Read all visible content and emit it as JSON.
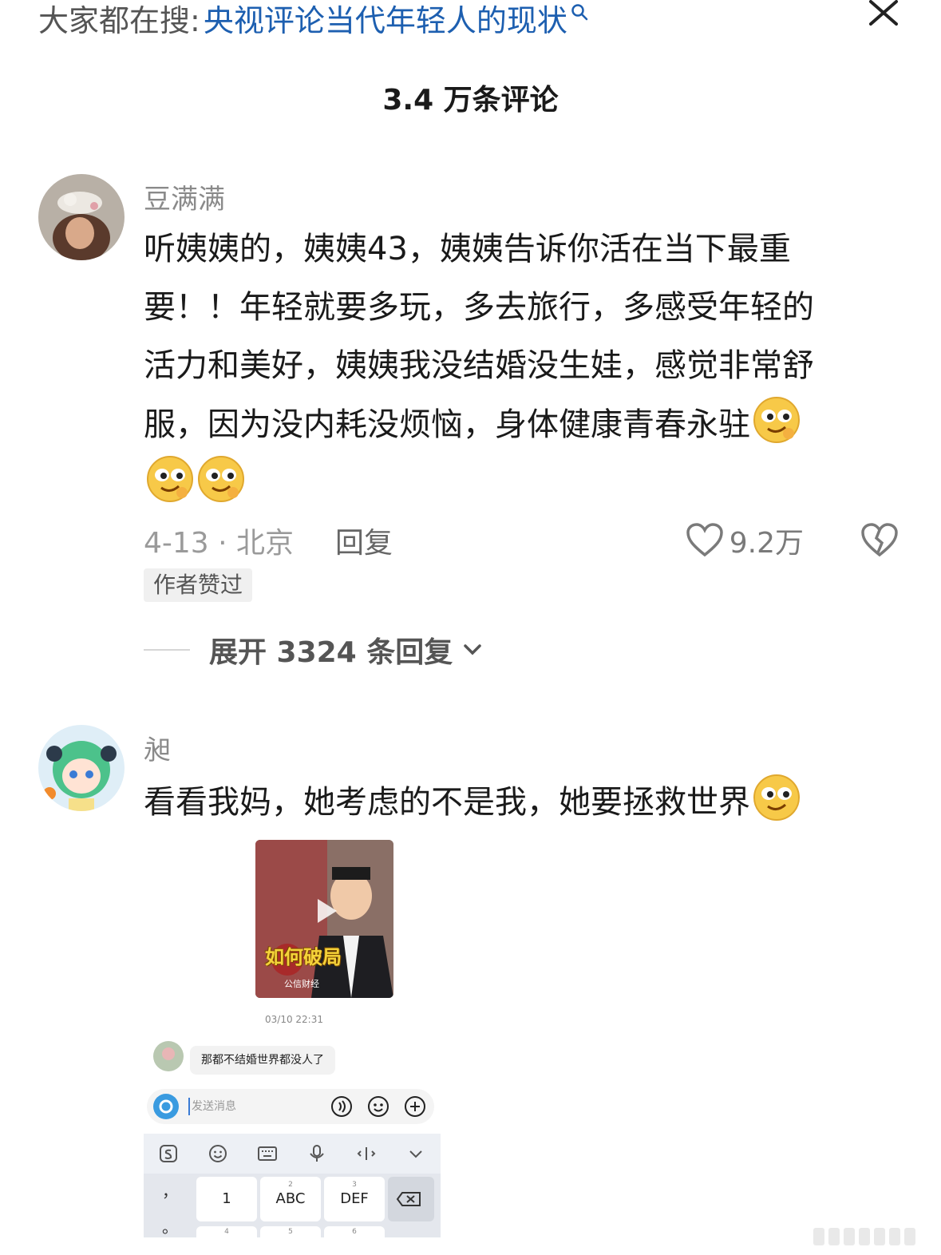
{
  "header": {
    "search_prefix": "大家都在搜:",
    "search_term": "央视评论当代年轻人的现状",
    "comment_count": "3.4 万条评论"
  },
  "comments": [
    {
      "username": "豆满满",
      "text_lines": [
        "听姨姨的，姨姨43，姨姨告诉你活在当下最重",
        "要！！年轻就要多玩，多去旅行，多感受年轻的",
        "活力和美好，姨姨我没结婚没生娃，感觉非常舒",
        "服，因为没内耗没烦恼，身体健康青春永驻"
      ],
      "emojis": [
        "smirk-emoji",
        "smirk-emoji",
        "smirk-emoji"
      ],
      "date_location": "4-13 · 北京",
      "reply_label": "回复",
      "like_count": "9.2万",
      "badge": "作者赞过",
      "expand_label": "展开 3324 条回复"
    },
    {
      "username": "昶",
      "text": "看看我妈，她考虑的不是我，她要拯救世界",
      "emojis": [
        "smirk-emoji"
      ],
      "attachment": {
        "video_caption": "如何破局",
        "video_channel": "公信财经",
        "timestamp": "03/10 22:31",
        "message": "那都不结婚世界都没人了",
        "input_placeholder": "发送消息",
        "keys": {
          "k1": "1",
          "k2": "ABC",
          "k2_num": "2",
          "k3": "DEF",
          "k3_num": "3",
          "side_top": "，",
          "side_bottom": "。",
          "r2_1": "4",
          "r2_2": "5",
          "r2_3": "6"
        }
      }
    }
  ],
  "colors": {
    "search_term": "#1d5fb0",
    "username": "#8a8a8a",
    "meta": "#9a9a9a",
    "badge_bg": "#f0f0f0"
  }
}
